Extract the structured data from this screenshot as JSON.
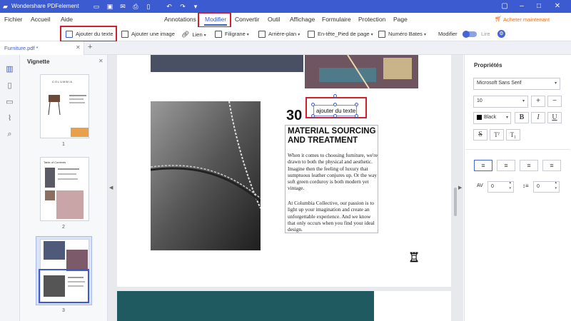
{
  "app": {
    "title": "Wondershare PDFelement",
    "buy_label": "Acheter maintenant"
  },
  "menu": {
    "items": [
      "Fichier",
      "Accueil",
      "Aide"
    ],
    "tabs": [
      "Annotations",
      "Modifier",
      "Convertir",
      "Outil",
      "Affichage",
      "Formulaire",
      "Protection",
      "Page"
    ],
    "active_tab": "Modifier"
  },
  "toolbar": {
    "add_text": "Ajouter du texte",
    "add_image": "Ajouter une image",
    "link": "Lien",
    "watermark": "Filigrane",
    "background": "Arrière-plan",
    "header_footer": "En-tête_Pied de page",
    "bates": "Numéro Bates",
    "edit_mode": "Modifier",
    "read_mode": "Lire"
  },
  "document": {
    "tab_name": "Furniture.pdf *"
  },
  "sidebar": {
    "title": "Vignette",
    "pages": [
      "1",
      "2",
      "3"
    ],
    "thumb1_brand": "COLUMBIA",
    "thumb2_title": "Table of Contents"
  },
  "page": {
    "number": "30",
    "heading_line1": "MATERIAL SOURCING",
    "heading_line2": "AND TREATMENT",
    "para1": "When it comes to choosing furniture, we're drawn to both the physical and aesthetic. Imagine then the feeling of luxury that sumptuous leather conjures up. Or the way soft green corduroy is both modern yet vintage.",
    "para2": "At Columbia Collective, our passion is to light up your imagination and create an unforgettable experience. And we know that only occurs when you find your ideal design.",
    "textbox": "ajouter du texte"
  },
  "properties": {
    "title": "Propriétés",
    "font": "Microsoft Sans Serif",
    "size": "10",
    "color_name": "Black",
    "color_hex": "#000000",
    "char_spacing": "0",
    "line_spacing": "0"
  },
  "colors": {
    "accent": "#3d5bd1",
    "highlight": "#d0202e",
    "teal": "#1f5a61"
  }
}
